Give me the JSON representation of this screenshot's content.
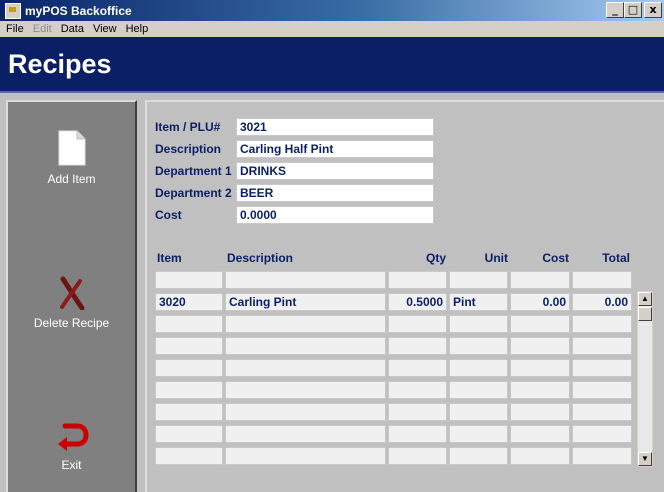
{
  "window": {
    "title": "myPOS Backoffice",
    "btn_min": "_",
    "btn_max": "□",
    "btn_close": "x"
  },
  "menu": {
    "file": "File",
    "edit": "Edit",
    "data": "Data",
    "view": "View",
    "help": "Help"
  },
  "header": {
    "title": "Recipes"
  },
  "sidebar": {
    "add": {
      "label": "Add Item",
      "icon": "document-icon"
    },
    "delete": {
      "label": "Delete Recipe",
      "icon": "x-mark-icon"
    },
    "exit": {
      "label": "Exit",
      "icon": "return-arrow-icon"
    }
  },
  "form": {
    "item_label": "Item / PLU#",
    "item_value": "3021",
    "desc_label": "Description",
    "desc_value": "Carling Half Pint",
    "dept1_label": "Department 1",
    "dept1_value": "DRINKS",
    "dept2_label": "Department 2",
    "dept2_value": "BEER",
    "cost_label": "Cost",
    "cost_value": "0.0000"
  },
  "table": {
    "headers": {
      "item": "Item",
      "description": "Description",
      "qty": "Qty",
      "unit": "Unit",
      "cost": "Cost",
      "total": "Total"
    },
    "rows": [
      {
        "item": "",
        "description": "",
        "qty": "",
        "unit": "",
        "cost": "",
        "total": ""
      },
      {
        "item": "3020",
        "description": "Carling Pint",
        "qty": "0.5000",
        "unit": "Pint",
        "cost": "0.00",
        "total": "0.00"
      },
      {
        "item": "",
        "description": "",
        "qty": "",
        "unit": "",
        "cost": "",
        "total": ""
      },
      {
        "item": "",
        "description": "",
        "qty": "",
        "unit": "",
        "cost": "",
        "total": ""
      },
      {
        "item": "",
        "description": "",
        "qty": "",
        "unit": "",
        "cost": "",
        "total": ""
      },
      {
        "item": "",
        "description": "",
        "qty": "",
        "unit": "",
        "cost": "",
        "total": ""
      },
      {
        "item": "",
        "description": "",
        "qty": "",
        "unit": "",
        "cost": "",
        "total": ""
      },
      {
        "item": "",
        "description": "",
        "qty": "",
        "unit": "",
        "cost": "",
        "total": ""
      },
      {
        "item": "",
        "description": "",
        "qty": "",
        "unit": "",
        "cost": "",
        "total": ""
      }
    ]
  },
  "colors": {
    "navy": "#0a1f66",
    "sidebar": "#808080",
    "background": "#c0c0c0",
    "delete_red": "#7a1a1a",
    "exit_red": "#cc0000"
  }
}
